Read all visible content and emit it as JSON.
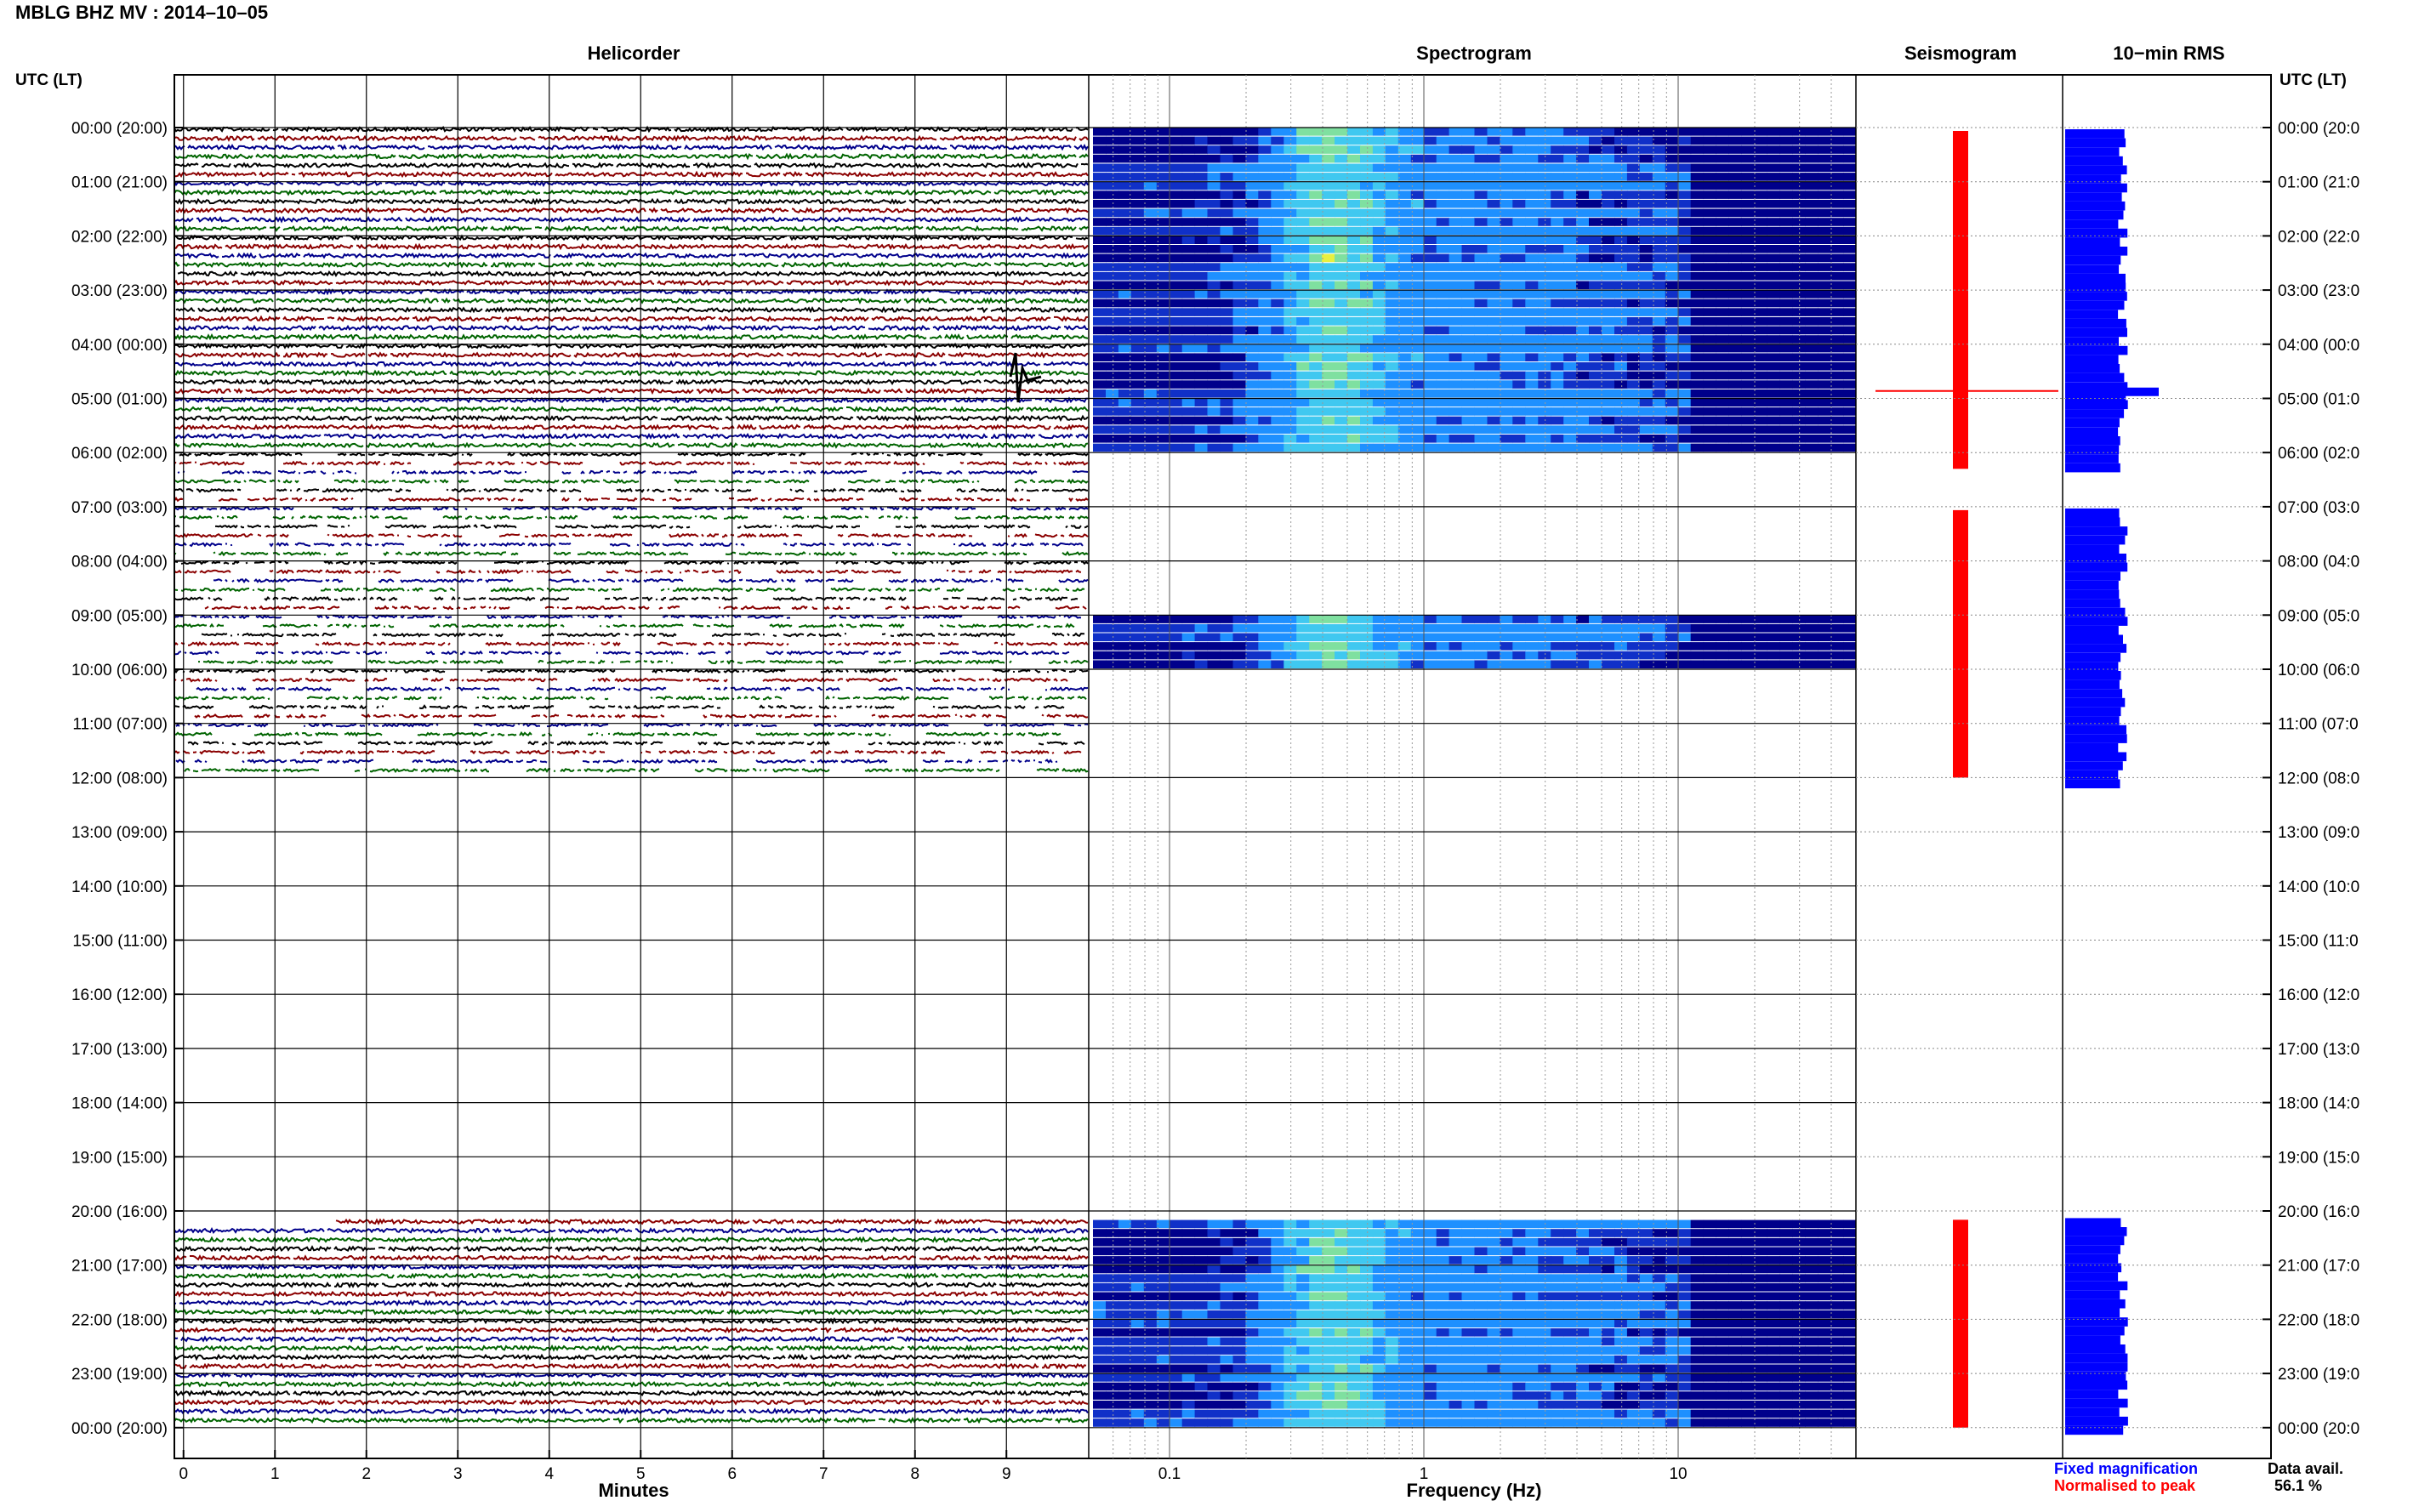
{
  "figure": {
    "title": "MBLG BHZ MV : 2014–10–05",
    "utc_label_left": "UTC (LT)",
    "utc_label_right": "UTC (LT)",
    "data_avail_label": "Data avail.",
    "data_avail_value": "56.1 %",
    "colors": {
      "black": "#000000",
      "red": "#8b0000",
      "blue": "#00008b",
      "green": "#006400",
      "seis_red": "#ff0000",
      "rms_blue": "#0000ff"
    }
  },
  "hour_labels": [
    "00:00 (20:00)",
    "01:00 (21:00)",
    "02:00 (22:00)",
    "03:00 (23:00)",
    "04:00 (00:00)",
    "05:00 (01:00)",
    "06:00 (02:00)",
    "07:00 (03:00)",
    "08:00 (04:00)",
    "09:00 (05:00)",
    "10:00 (06:00)",
    "11:00 (07:00)",
    "12:00 (08:00)",
    "13:00 (09:00)",
    "14:00 (10:00)",
    "15:00 (11:00)",
    "16:00 (12:00)",
    "17:00 (13:00)",
    "18:00 (14:00)",
    "19:00 (15:00)",
    "20:00 (16:00)",
    "21:00 (17:00)",
    "22:00 (18:00)",
    "23:00 (19:00)",
    "00:00 (20:00)"
  ],
  "chart_data": [
    {
      "type": "line",
      "title": "Helicorder",
      "xlabel": "Minutes",
      "x_ticks": [
        "0",
        "1",
        "2",
        "3",
        "4",
        "5",
        "6",
        "7",
        "8",
        "9"
      ],
      "xlim": [
        0,
        10
      ],
      "rows_per_hour": 6,
      "trace_colors_cycle": [
        "black",
        "red",
        "blue",
        "green"
      ],
      "data_present_hours": [
        [
          0,
          12
        ],
        [
          20.1,
          24
        ]
      ],
      "gap_heavy_hours": [
        [
          6,
          12
        ]
      ],
      "notable_event": {
        "hour": 4.6,
        "minute": 9.2
      }
    },
    {
      "type": "heatmap",
      "title": "Spectrogram",
      "xlabel": "Frequency (Hz)",
      "x_scale": "log",
      "xlim": [
        0.05,
        50
      ],
      "x_ticks": [
        "0.1",
        "1",
        "10"
      ],
      "data_present_hours": [
        [
          0,
          6
        ],
        [
          9,
          10
        ],
        [
          11.2,
          11.3
        ],
        [
          20.1,
          24
        ]
      ]
    },
    {
      "type": "line",
      "title": "Seismogram",
      "data_present_hours": [
        [
          0,
          6.3
        ],
        [
          7,
          12
        ],
        [
          20.1,
          24
        ]
      ]
    },
    {
      "type": "bar",
      "title": "10−min RMS",
      "data_present_hours": [
        [
          0,
          6.3
        ],
        [
          7,
          12.1
        ],
        [
          20.1,
          24
        ]
      ],
      "spike_hour": 4.8
    }
  ],
  "legend": {
    "fixed": "Fixed magnification",
    "normalised": "Normalised to peak",
    "fixed_color": "#0000ff",
    "normalised_color": "#ff0000"
  }
}
